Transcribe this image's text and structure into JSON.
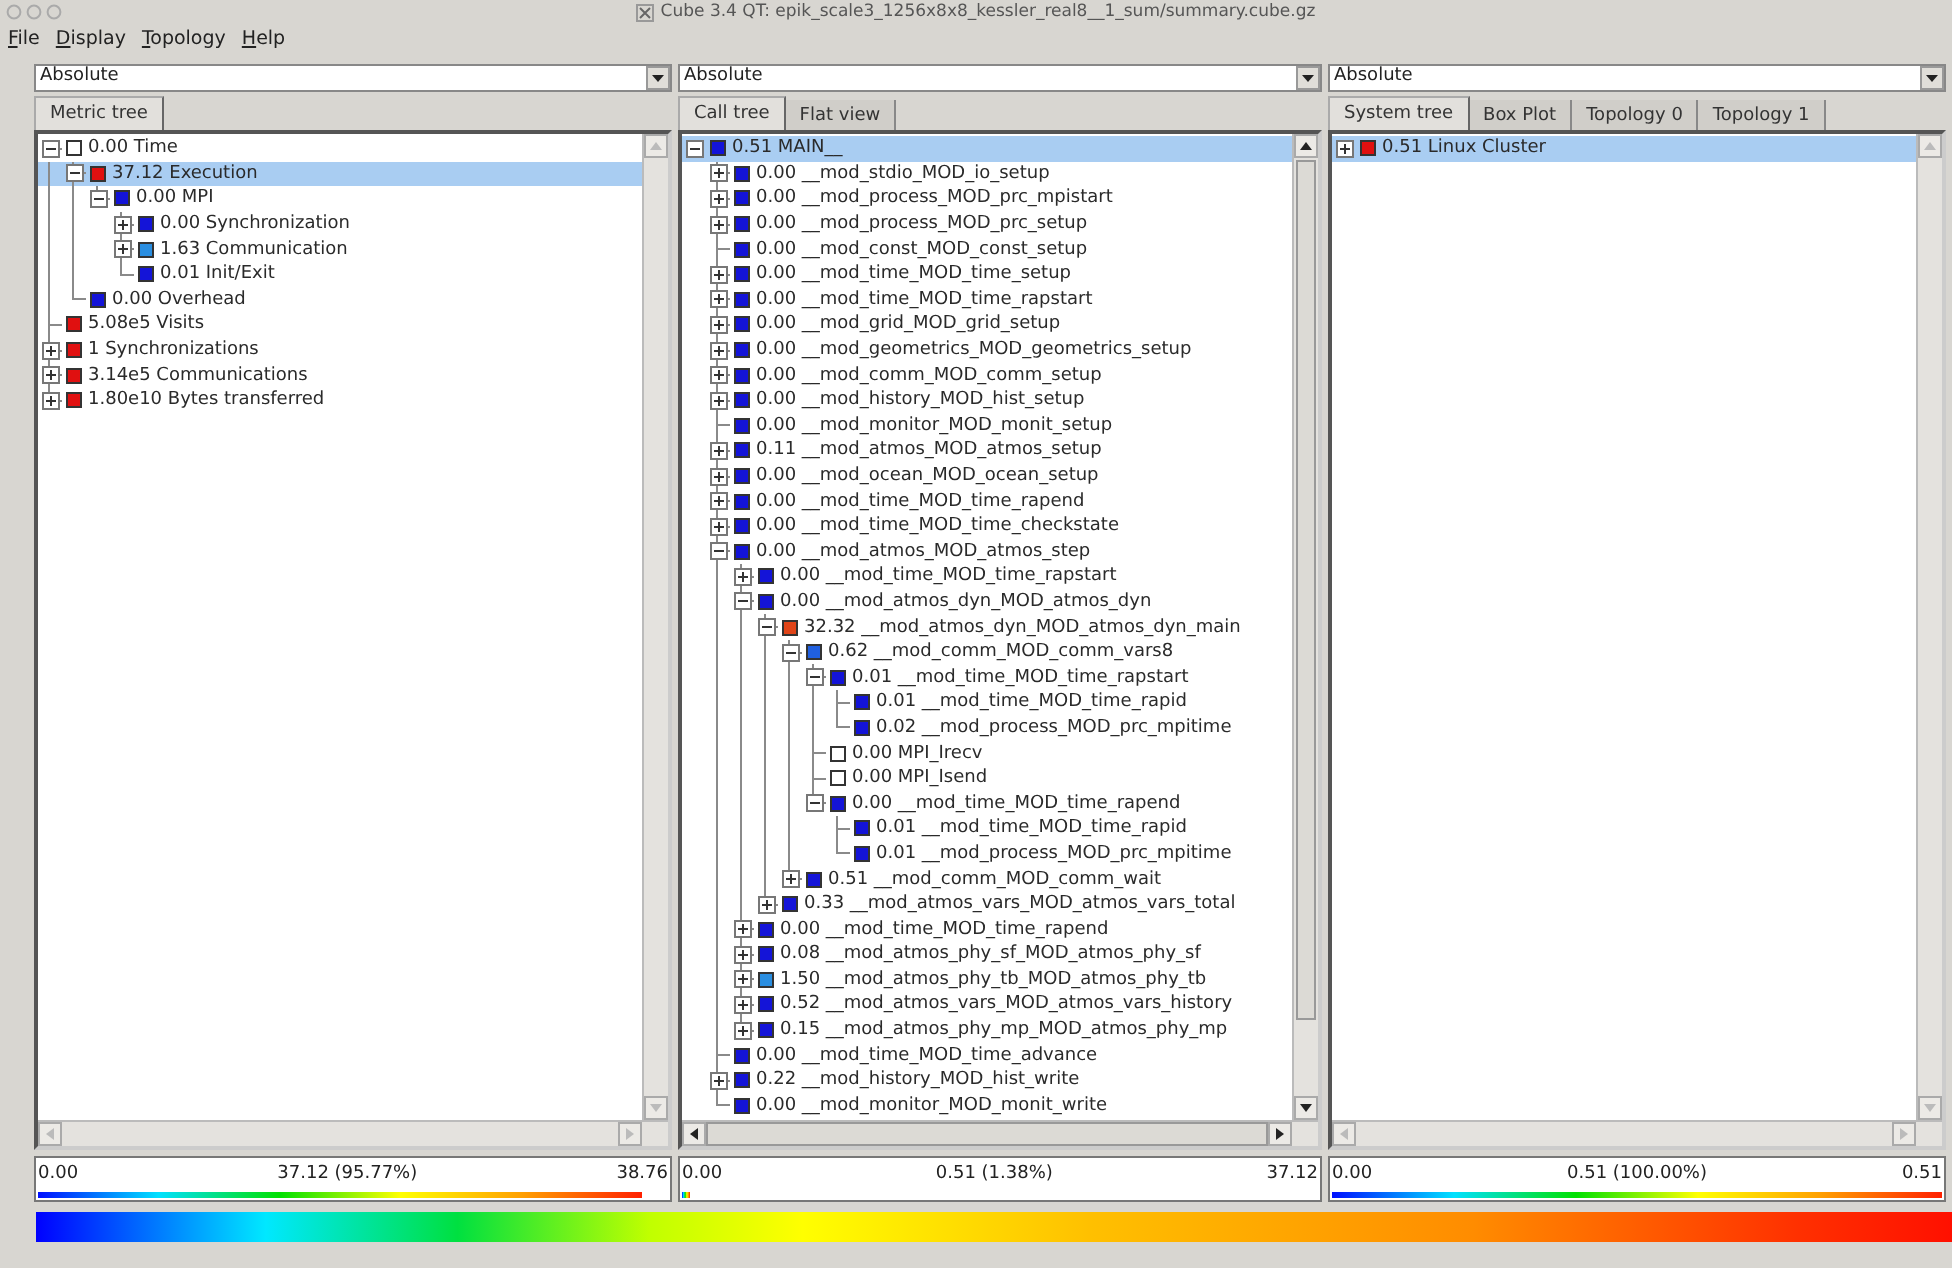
{
  "window": {
    "title": "Cube 3.4 QT: epik_scale3_1256x8x8_kessler_real8__1_sum/summary.cube.gz"
  },
  "menu": [
    "File",
    "Display",
    "Topology",
    "Help"
  ],
  "panes": [
    {
      "combo": "Absolute",
      "tabs": [
        {
          "label": "Metric tree",
          "selected": true
        }
      ],
      "tree": [
        {
          "text": "0.00 Time",
          "color": "#ffffff",
          "selected": false,
          "expanded": true,
          "children": [
            {
              "text": "37.12 Execution",
              "color": "#e01010",
              "selected": true,
              "expanded": true,
              "children": [
                {
                  "text": "0.00 MPI",
                  "color": "#1414d8",
                  "selected": false,
                  "expanded": true,
                  "children": [
                    {
                      "text": "0.00 Synchronization",
                      "color": "#1414d8",
                      "selected": false,
                      "expanded": false
                    },
                    {
                      "text": "1.63 Communication",
                      "color": "#2a8ee0",
                      "selected": false,
                      "expanded": false
                    },
                    {
                      "text": "0.01 Init/Exit",
                      "color": "#1414d8",
                      "selected": false
                    }
                  ]
                }
              ]
            },
            {
              "text": "0.00 Overhead",
              "color": "#1414d8",
              "selected": false
            }
          ]
        },
        {
          "text": "5.08e5 Visits",
          "color": "#e01010",
          "selected": false
        },
        {
          "text": "1 Synchronizations",
          "color": "#e01010",
          "selected": false,
          "expanded": false
        },
        {
          "text": "3.14e5 Communications",
          "color": "#e01010",
          "selected": false,
          "expanded": false
        },
        {
          "text": "1.80e10 Bytes transferred",
          "color": "#e01010",
          "selected": false,
          "expanded": false
        }
      ],
      "value_bar": {
        "min": "0.00",
        "current": "37.12 (95.77%)",
        "max": "38.76",
        "level": 0.96
      }
    },
    {
      "combo": "Absolute",
      "tabs": [
        {
          "label": "Call tree",
          "selected": true
        },
        {
          "label": "Flat view",
          "selected": false
        }
      ],
      "tree": [
        {
          "text": "0.51 MAIN__",
          "color": "#1414d8",
          "selected": true,
          "expanded": true,
          "children": [
            {
              "text": "0.00 __mod_stdio_MOD_io_setup",
              "color": "#1414d8",
              "selected": false,
              "expanded": false
            },
            {
              "text": "0.00 __mod_process_MOD_prc_mpistart",
              "color": "#1414d8",
              "selected": false,
              "expanded": false
            },
            {
              "text": "0.00 __mod_process_MOD_prc_setup",
              "color": "#1414d8",
              "selected": false,
              "expanded": false
            },
            {
              "text": "0.00 __mod_const_MOD_const_setup",
              "color": "#1414d8",
              "selected": false
            },
            {
              "text": "0.00 __mod_time_MOD_time_setup",
              "color": "#1414d8",
              "selected": false,
              "expanded": false
            },
            {
              "text": "0.00 __mod_time_MOD_time_rapstart",
              "color": "#1414d8",
              "selected": false,
              "expanded": false
            },
            {
              "text": "0.00 __mod_grid_MOD_grid_setup",
              "color": "#1414d8",
              "selected": false,
              "expanded": false
            },
            {
              "text": "0.00 __mod_geometrics_MOD_geometrics_setup",
              "color": "#1414d8",
              "selected": false,
              "expanded": false
            },
            {
              "text": "0.00 __mod_comm_MOD_comm_setup",
              "color": "#1414d8",
              "selected": false,
              "expanded": false
            },
            {
              "text": "0.00 __mod_history_MOD_hist_setup",
              "color": "#1414d8",
              "selected": false,
              "expanded": false
            },
            {
              "text": "0.00 __mod_monitor_MOD_monit_setup",
              "color": "#1414d8",
              "selected": false
            },
            {
              "text": "0.11 __mod_atmos_MOD_atmos_setup",
              "color": "#1414d8",
              "selected": false,
              "expanded": false
            },
            {
              "text": "0.00 __mod_ocean_MOD_ocean_setup",
              "color": "#1414d8",
              "selected": false,
              "expanded": false
            },
            {
              "text": "0.00 __mod_time_MOD_time_rapend",
              "color": "#1414d8",
              "selected": false,
              "expanded": false
            },
            {
              "text": "0.00 __mod_time_MOD_time_checkstate",
              "color": "#1414d8",
              "selected": false,
              "expanded": false
            },
            {
              "text": "0.00 __mod_atmos_MOD_atmos_step",
              "color": "#1414d8",
              "selected": false,
              "expanded": true,
              "children": [
                {
                  "text": "0.00 __mod_time_MOD_time_rapstart",
                  "color": "#1414d8",
                  "selected": false,
                  "expanded": false
                },
                {
                  "text": "0.00 __mod_atmos_dyn_MOD_atmos_dyn",
                  "color": "#1414d8",
                  "selected": false,
                  "expanded": true,
                  "children": [
                    {
                      "text": "32.32 __mod_atmos_dyn_MOD_atmos_dyn_main",
                      "color": "#e04418",
                      "selected": false,
                      "expanded": true,
                      "children": [
                        {
                          "text": "0.62 __mod_comm_MOD_comm_vars8",
                          "color": "#2060e0",
                          "selected": false,
                          "expanded": true,
                          "children": [
                            {
                              "text": "0.01 __mod_time_MOD_time_rapstart",
                              "color": "#1414d8",
                              "selected": false,
                              "expanded": true,
                              "children": [
                                {
                                  "text": "0.01 __mod_time_MOD_time_rapid",
                                  "color": "#1414d8",
                                  "selected": false
                                },
                                {
                                  "text": "0.02 __mod_process_MOD_prc_mpitime",
                                  "color": "#1414d8",
                                  "selected": false
                                }
                              ]
                            },
                            {
                              "text": "0.00 MPI_Irecv",
                              "color": "#ffffff",
                              "selected": false
                            },
                            {
                              "text": "0.00 MPI_Isend",
                              "color": "#ffffff",
                              "selected": false
                            },
                            {
                              "text": "0.00 __mod_time_MOD_time_rapend",
                              "color": "#1414d8",
                              "selected": false,
                              "expanded": true,
                              "children": [
                                {
                                  "text": "0.01 __mod_time_MOD_time_rapid",
                                  "color": "#1414d8",
                                  "selected": false
                                },
                                {
                                  "text": "0.01 __mod_process_MOD_prc_mpitime",
                                  "color": "#1414d8",
                                  "selected": false
                                }
                              ]
                            }
                          ]
                        },
                        {
                          "text": "0.51 __mod_comm_MOD_comm_wait",
                          "color": "#1414d8",
                          "selected": false,
                          "expanded": false
                        }
                      ]
                    },
                    {
                      "text": "0.33 __mod_atmos_vars_MOD_atmos_vars_total",
                      "color": "#1414d8",
                      "selected": false,
                      "expanded": false
                    }
                  ]
                },
                {
                  "text": "0.00 __mod_time_MOD_time_rapend",
                  "color": "#1414d8",
                  "selected": false,
                  "expanded": false
                },
                {
                  "text": "0.08 __mod_atmos_phy_sf_MOD_atmos_phy_sf",
                  "color": "#1414d8",
                  "selected": false,
                  "expanded": false
                },
                {
                  "text": "1.50 __mod_atmos_phy_tb_MOD_atmos_phy_tb",
                  "color": "#2a8ee0",
                  "selected": false,
                  "expanded": false
                },
                {
                  "text": "0.52 __mod_atmos_vars_MOD_atmos_vars_history",
                  "color": "#1414d8",
                  "selected": false,
                  "expanded": false
                },
                {
                  "text": "0.15 __mod_atmos_phy_mp_MOD_atmos_phy_mp",
                  "color": "#1414d8",
                  "selected": false,
                  "expanded": false
                }
              ]
            },
            {
              "text": "0.00 __mod_time_MOD_time_advance",
              "color": "#1414d8",
              "selected": false
            },
            {
              "text": "0.22 __mod_history_MOD_hist_write",
              "color": "#1414d8",
              "selected": false,
              "expanded": false
            },
            {
              "text": "0.00 __mod_monitor_MOD_monit_write",
              "color": "#1414d8",
              "selected": false
            }
          ]
        }
      ],
      "value_bar": {
        "min": "0.00",
        "current": "0.51 (1.38%)",
        "max": "37.12",
        "level": 0.014
      }
    },
    {
      "combo": "Absolute",
      "tabs": [
        {
          "label": "System tree",
          "selected": true
        },
        {
          "label": "Box Plot",
          "selected": false
        },
        {
          "label": "Topology 0",
          "selected": false
        },
        {
          "label": "Topology 1",
          "selected": false
        }
      ],
      "tree": [
        {
          "text": "0.51 Linux Cluster",
          "color": "#e01010",
          "selected": true,
          "expanded": false
        }
      ],
      "value_bar": {
        "min": "0.00",
        "current": "0.51 (100.00%)",
        "max": "0.51",
        "level": 1
      }
    }
  ]
}
